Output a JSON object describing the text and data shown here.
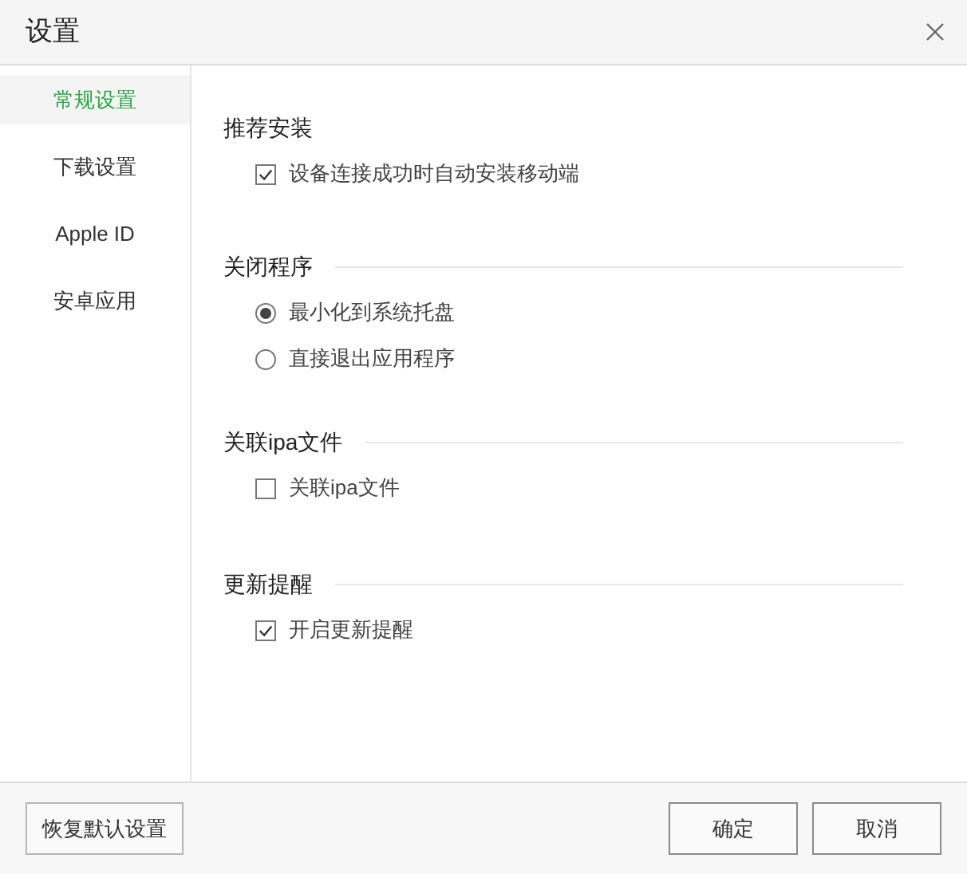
{
  "window": {
    "title": "设置"
  },
  "sidebar": {
    "items": [
      {
        "label": "常规设置",
        "selected": true
      },
      {
        "label": "下载设置",
        "selected": false
      },
      {
        "label": "Apple ID",
        "selected": false
      },
      {
        "label": "安卓应用",
        "selected": false
      }
    ]
  },
  "sections": [
    {
      "title": "推荐安装",
      "rule": false,
      "options": [
        {
          "kind": "checkbox",
          "label": "设备连接成功时自动安装移动端",
          "checked": true
        }
      ]
    },
    {
      "title": "关闭程序",
      "rule": true,
      "options": [
        {
          "kind": "radio",
          "label": "最小化到系统托盘",
          "checked": true
        },
        {
          "kind": "radio",
          "label": "直接退出应用程序",
          "checked": false
        }
      ]
    },
    {
      "title": "关联ipa文件",
      "rule": true,
      "options": [
        {
          "kind": "checkbox",
          "label": "关联ipa文件",
          "checked": false
        }
      ]
    },
    {
      "title": "更新提醒",
      "rule": true,
      "options": [
        {
          "kind": "checkbox",
          "label": "开启更新提醒",
          "checked": true
        }
      ]
    }
  ],
  "footer": {
    "reset_button": "恢复默认设置",
    "buttons": [
      "确定",
      "取消"
    ]
  }
}
